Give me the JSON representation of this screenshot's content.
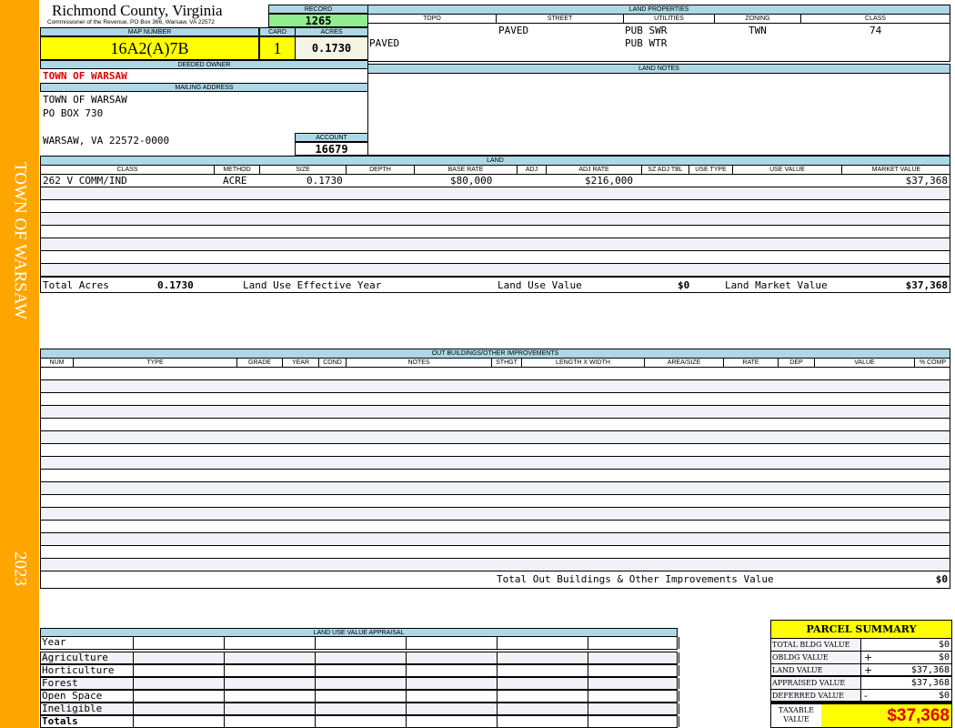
{
  "sidebar": {
    "title": "TOWN OF WARSAW",
    "year": "2023",
    "color": "#FFA500"
  },
  "header": {
    "county": "Richmond County, Virginia",
    "office": "Commissioner of the Revenue, PO Box 366, Warsaw, VA 22572"
  },
  "record": {
    "label": "RECORD",
    "value": "1265"
  },
  "map": {
    "label": "MAP NUMBER",
    "value": "16A2(A)7B"
  },
  "card": {
    "label": "CARD",
    "value": "1"
  },
  "acres": {
    "label": "ACRES",
    "value": "0.1730"
  },
  "owner": {
    "label": "DEEDED OWNER",
    "value": "TOWN OF WARSAW"
  },
  "mailing": {
    "label": "MAILING ADDRESS",
    "line1": "TOWN OF WARSAW",
    "line2": "PO BOX 730",
    "line3": "WARSAW, VA 22572-0000"
  },
  "account": {
    "label": "ACCOUNT",
    "value": "16679"
  },
  "land_properties": {
    "label": "LAND PROPERTIES",
    "columns": [
      "TOPO",
      "STREET",
      "UTILITIES",
      "ZONING",
      "CLASS"
    ],
    "street": "PAVED",
    "utilities1": "PUB SWR",
    "zoning": "TWN",
    "class": "74",
    "topo2": "PAVED",
    "utilities2": "PUB WTR"
  },
  "land_notes": {
    "label": "LAND NOTES"
  },
  "land": {
    "label": "LAND",
    "columns": [
      "CLASS",
      "METHOD",
      "SIZE",
      "DEPTH",
      "BASE RATE",
      "ADJ",
      "ADJ RATE",
      "SZ ADJ TBL",
      "USE TYPE",
      "USE VALUE",
      "MARKET VALUE"
    ],
    "row": {
      "class": "262 V COMM/IND",
      "method": "ACRE",
      "size": "0.1730",
      "base_rate": "$80,000",
      "adj_rate": "$216,000",
      "market_value": "$37,368"
    },
    "totals": {
      "acres_label": "Total Acres",
      "acres": "0.1730",
      "year_label": "Land Use Effective Year",
      "use_label": "Land Use Value",
      "use_value": "$0",
      "market_label": "Land Market Value",
      "market_value": "$37,368"
    }
  },
  "outbuildings": {
    "label": "OUT BUILDINGS/OTHER IMPROVEMENTS",
    "columns": [
      "NUM",
      "TYPE",
      "GRADE",
      "YEAR",
      "COND",
      "NOTES",
      "STHGT",
      "LENGTH X WIDTH",
      "AREA/SIZE",
      "RATE",
      "DEP",
      "VALUE",
      "% COMP"
    ],
    "total_label": "Total Out Buildings & Other Improvements Value",
    "total": "$0"
  },
  "luva": {
    "label": "LAND USE VALUE APPRAISAL",
    "year": "Year",
    "rows": [
      "Agriculture",
      "Horticulture",
      "Forest",
      "Open Space",
      "Ineligible"
    ],
    "totals": "Totals"
  },
  "summary": {
    "title": "PARCEL SUMMARY",
    "rows": [
      {
        "label": "TOTAL BLDG VALUE",
        "sign": "",
        "value": "$0"
      },
      {
        "label": "OBLDG VALUE",
        "sign": "+",
        "value": "$0"
      },
      {
        "label": "LAND VALUE",
        "sign": "+",
        "value": "$37,368"
      },
      {
        "label": "APPRAISED VALUE",
        "sign": "",
        "value": "$37,368"
      },
      {
        "label": "DEFERRED VALUE",
        "sign": "-",
        "value": "$0"
      }
    ],
    "taxable_label": "TAXABLE VALUE",
    "taxable": "$37,368"
  }
}
